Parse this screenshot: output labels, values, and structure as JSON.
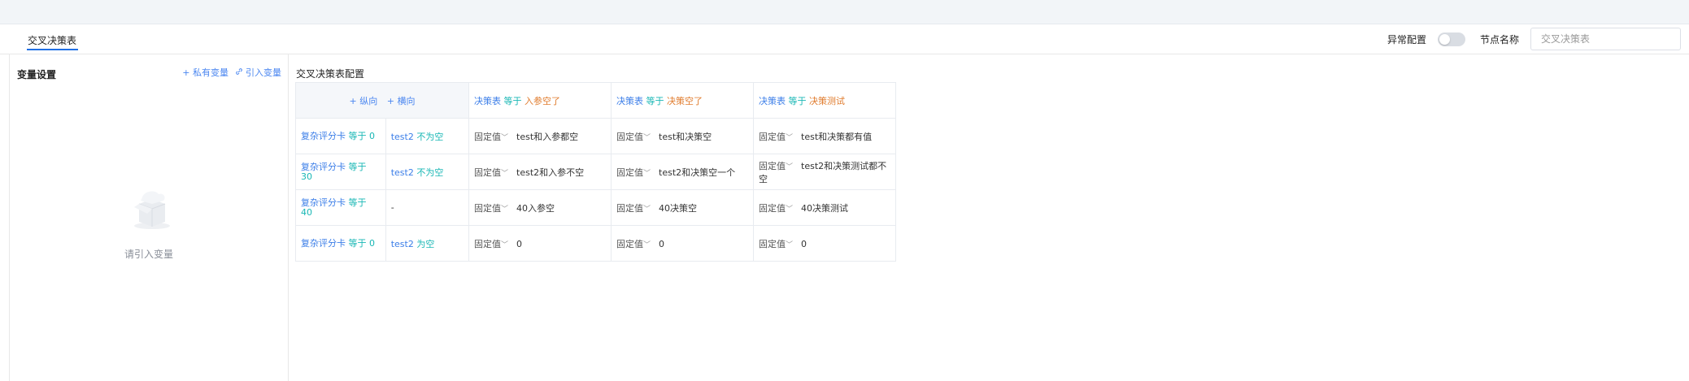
{
  "tabs": [
    {
      "label": "交叉决策表",
      "active": true
    }
  ],
  "toolbar": {
    "exception_label": "异常配置",
    "exception_enabled": false,
    "node_name_label": "节点名称",
    "node_name_placeholder": "交叉决策表"
  },
  "variables": {
    "title": "变量设置",
    "private_label": "+ 私有变量",
    "import_label": "引入变量",
    "empty_text": "请引入变量"
  },
  "config": {
    "title": "交叉决策表配置",
    "vertical_label": "+ 纵向",
    "horizontal_label": "+ 横向",
    "columns": [
      {
        "var": "决策表",
        "op": "等于",
        "value": "入参空了"
      },
      {
        "var": "决策表",
        "op": "等于",
        "value": "决策空了"
      },
      {
        "var": "决策表",
        "op": "等于",
        "value": "决策测试"
      }
    ],
    "rows": [
      {
        "var": "复杂评分卡",
        "op": "等于",
        "num": "0",
        "cond_var": "test2",
        "cond": "不为空",
        "cells": [
          {
            "type": "固定值",
            "value": "test和入参都空"
          },
          {
            "type": "固定值",
            "value": "test和决策空"
          },
          {
            "type": "固定值",
            "value": "test和决策都有值"
          }
        ]
      },
      {
        "var": "复杂评分卡",
        "op": "等于",
        "num": "30",
        "cond_var": "test2",
        "cond": "不为空",
        "cells": [
          {
            "type": "固定值",
            "value": "test2和入参不空"
          },
          {
            "type": "固定值",
            "value": "test2和决策空一个"
          },
          {
            "type": "固定值",
            "value": "test2和决策测试都不空"
          }
        ]
      },
      {
        "var": "复杂评分卡",
        "op": "等于",
        "num": "40",
        "cond_var": "",
        "cond": "-",
        "cells": [
          {
            "type": "固定值",
            "value": "40入参空"
          },
          {
            "type": "固定值",
            "value": "40决策空"
          },
          {
            "type": "固定值",
            "value": "40决策测试"
          }
        ]
      },
      {
        "var": "复杂评分卡",
        "op": "等于",
        "num": "0",
        "cond_var": "test2",
        "cond": "为空",
        "cells": [
          {
            "type": "固定值",
            "value": "0"
          },
          {
            "type": "固定值",
            "value": "0"
          },
          {
            "type": "固定值",
            "value": "0"
          }
        ]
      }
    ]
  }
}
